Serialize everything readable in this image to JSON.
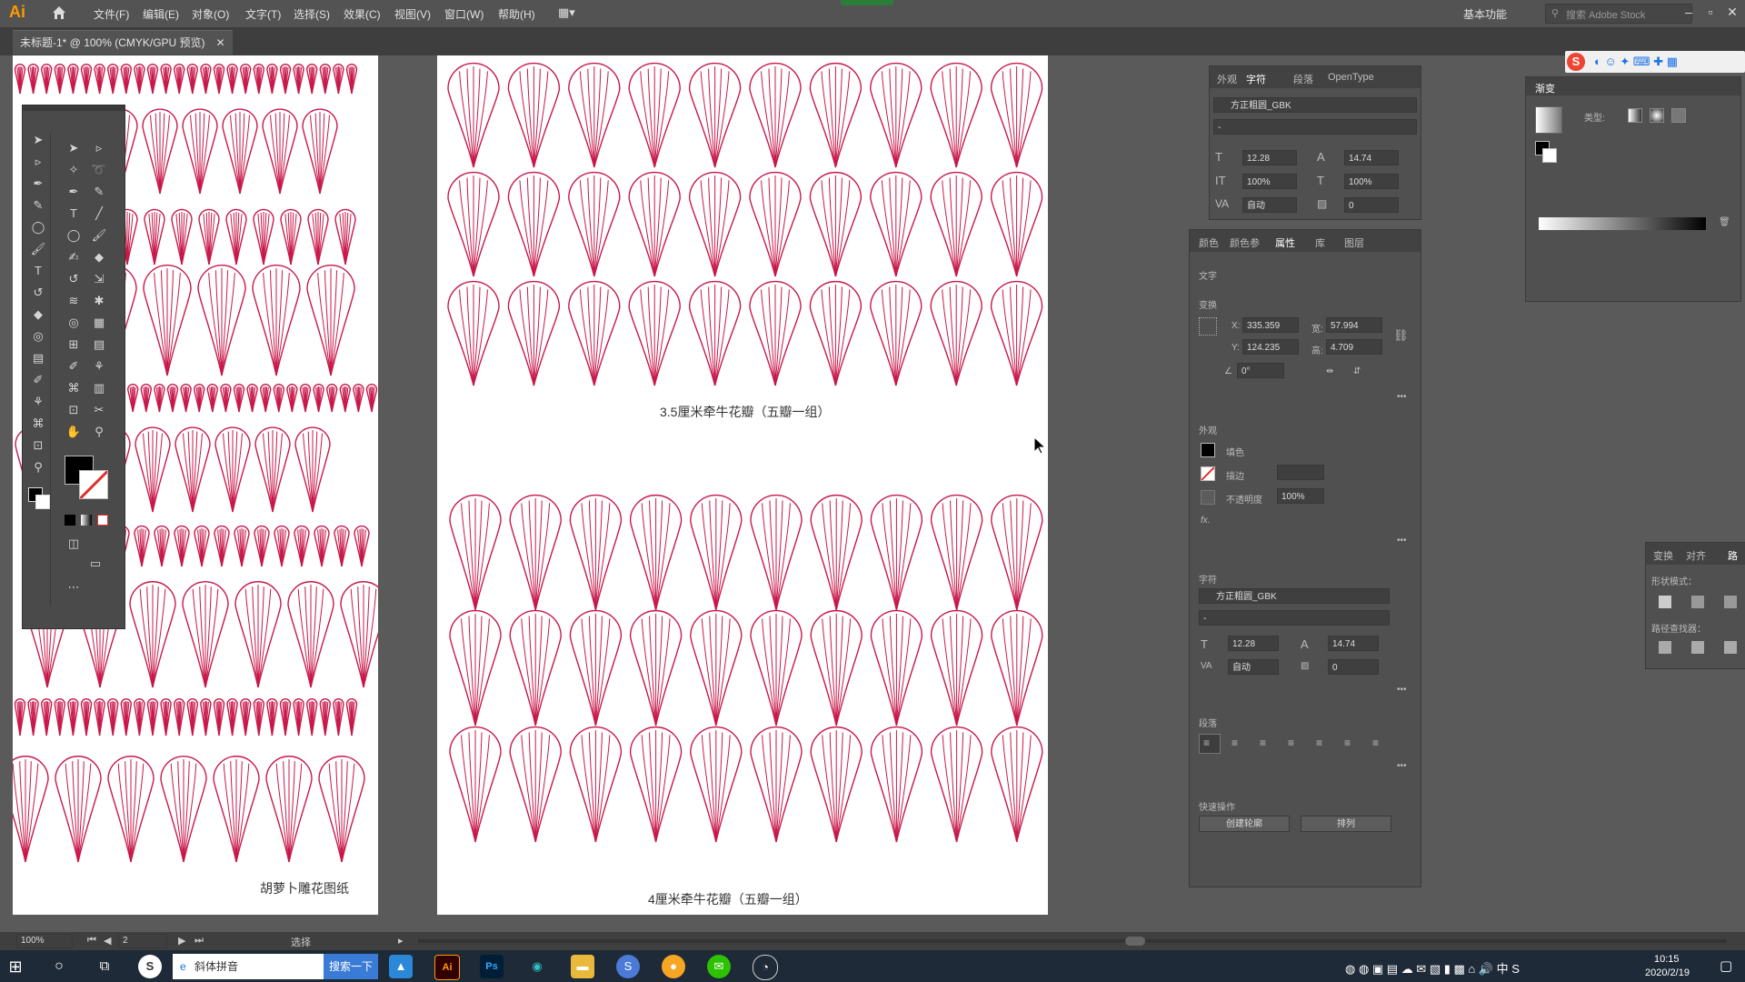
{
  "app": {
    "logo": "Ai"
  },
  "menu": [
    "文件(F)",
    "编辑(E)",
    "对象(O)",
    "文字(T)",
    "选择(S)",
    "效果(C)",
    "视图(V)",
    "窗口(W)",
    "帮助(H)"
  ],
  "workspace": "基本功能",
  "search_placeholder": "搜索 Adobe Stock",
  "document_tab": "未标题-1* @ 100% (CMYK/GPU 预览)",
  "artboards": {
    "left_caption": "胡萝卜雕花图纸",
    "caption_35": "3.5厘米牵牛花瓣（五瓣一组）",
    "caption_4": "4厘米牵牛花瓣（五瓣一组）"
  },
  "colors": {
    "petal": "#c8184a",
    "canvas": "#5a5a5a",
    "panel": "#505050"
  },
  "character_panel": {
    "tabs": [
      "外观",
      "字符",
      "段落",
      "OpenType"
    ],
    "font": "方正粗圆_GBK",
    "style": "-",
    "size": "12.28",
    "leading": "14.74",
    "vscale": "100%",
    "hscale": "100%",
    "kerning": "自动",
    "tracking": "0"
  },
  "properties_panel": {
    "tabs": [
      "颜色",
      "颜色参",
      "属性",
      "库",
      "图层"
    ],
    "sec_text": "文字",
    "sec_transform": "变换",
    "x_label": "X:",
    "x": "335.359",
    "y_label": "Y:",
    "y": "124.235",
    "w_label": "宽:",
    "w": "57.994",
    "h_label": "高:",
    "h": "4.709",
    "rotate": "0°",
    "sec_appearance": "外观",
    "fill_label": "填色",
    "stroke_label": "描边",
    "opacity_label": "不透明度",
    "opacity": "100%",
    "fx": "fx.",
    "sec_char": "字符",
    "font": "方正粗圆_GBK",
    "style": "-",
    "size": "12.28",
    "leading": "14.74",
    "kerning": "自动",
    "tracking": "0",
    "sec_para": "段落",
    "sec_quick": "快速操作",
    "btn_outline": "创建轮廓",
    "btn_arrange": "排列"
  },
  "gradient_panel": {
    "title": "渐变",
    "type_label": "类型:"
  },
  "pathfinder_panel": {
    "tabs": [
      "变换",
      "对齐",
      "路"
    ],
    "shape_modes": "形状模式：",
    "pathfinders": "路径查找器："
  },
  "statusbar": {
    "zoom": "100%",
    "page": "2",
    "mode": "选择"
  },
  "taskbar": {
    "search_app": "斜体拼音",
    "task_btn": "搜索一下",
    "time": "10:15",
    "date": "2020/2/19"
  }
}
